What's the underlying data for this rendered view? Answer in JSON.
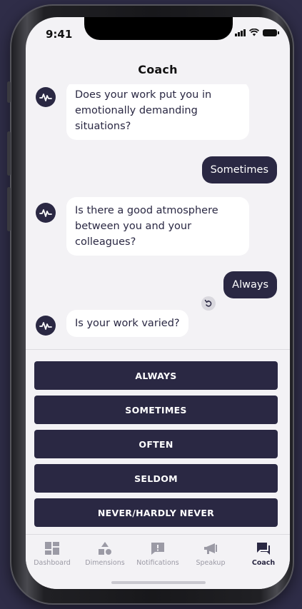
{
  "status_bar": {
    "time": "9:41"
  },
  "header": {
    "title": "Coach"
  },
  "chat": {
    "messages": [
      {
        "from": "coach",
        "text": "Does your work put you in emotionally demanding situations?"
      },
      {
        "from": "user",
        "text": "Sometimes"
      },
      {
        "from": "coach",
        "text": "Is there a good atmosphere between you and your colleagues?"
      },
      {
        "from": "user",
        "text": "Always"
      },
      {
        "from": "coach",
        "text": "Is your work varied?"
      }
    ]
  },
  "answers": [
    "ALWAYS",
    "SOMETIMES",
    "OFTEN",
    "SELDOM",
    "NEVER/HARDLY NEVER"
  ],
  "tabs": [
    {
      "label": "Dashboard",
      "icon": "dashboard-icon"
    },
    {
      "label": "Dimensions",
      "icon": "shapes-icon"
    },
    {
      "label": "Notifications",
      "icon": "alert-icon"
    },
    {
      "label": "Speakup",
      "icon": "megaphone-icon"
    },
    {
      "label": "Coach",
      "icon": "chat-icon",
      "active": true
    }
  ],
  "colors": {
    "accent": "#2a2843",
    "background": "#f3f2f5",
    "frame_bg": "#2f2d48"
  }
}
